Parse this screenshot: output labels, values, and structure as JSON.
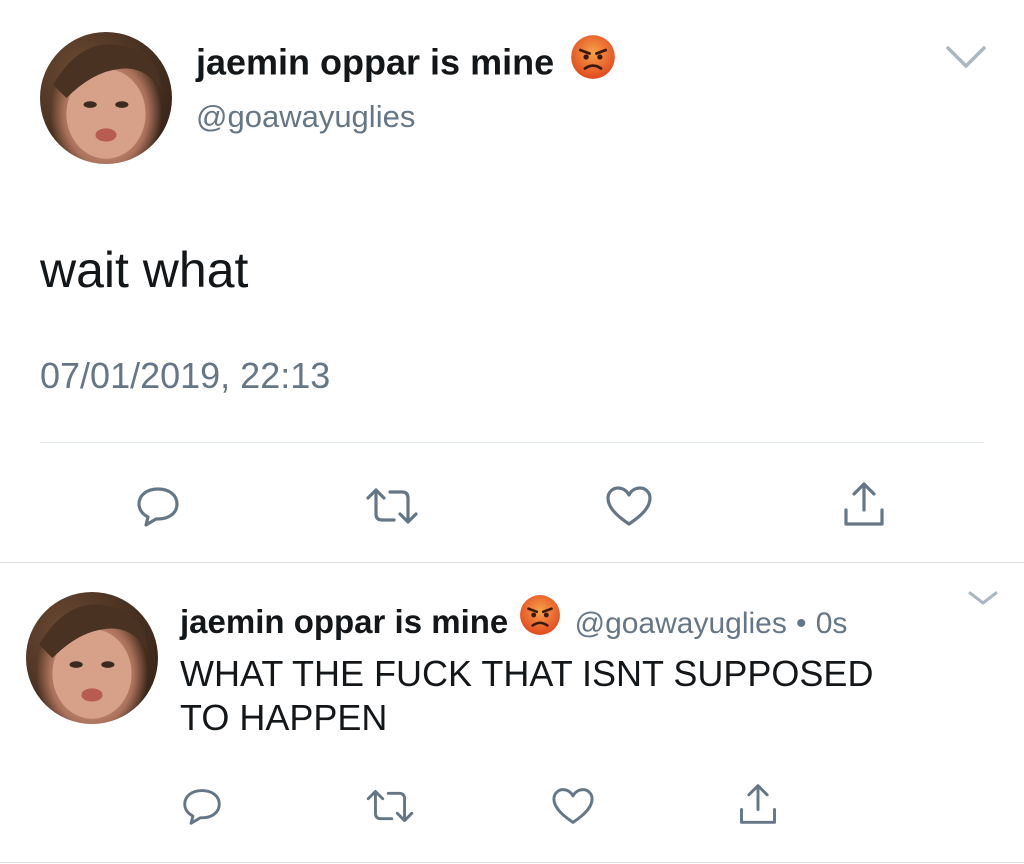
{
  "main_tweet": {
    "display_name": "jaemin oppar is mine",
    "emoji_icon": "angry-face-emoji",
    "handle": "@goawayuglies",
    "text": "wait what",
    "timestamp": "07/01/2019, 22:13",
    "actions": [
      "reply-icon",
      "retweet-icon",
      "like-icon",
      "share-icon"
    ]
  },
  "reply_tweet": {
    "display_name": "jaemin oppar is mine",
    "emoji_icon": "angry-face-emoji",
    "handle": "@goawayuglies",
    "separator": "•",
    "time_ago": "0s",
    "text_line1": "WHAT THE FUCK THAT ISNT SUPPOSED",
    "text_line2": "TO HAPPEN",
    "actions": [
      "reply-icon",
      "retweet-icon",
      "like-icon",
      "share-icon"
    ]
  },
  "colors": {
    "text": "#14171a",
    "secondary": "#657786",
    "divider": "#e1e8ed",
    "icon": "#657786",
    "emoji_face": "#e8562a"
  }
}
